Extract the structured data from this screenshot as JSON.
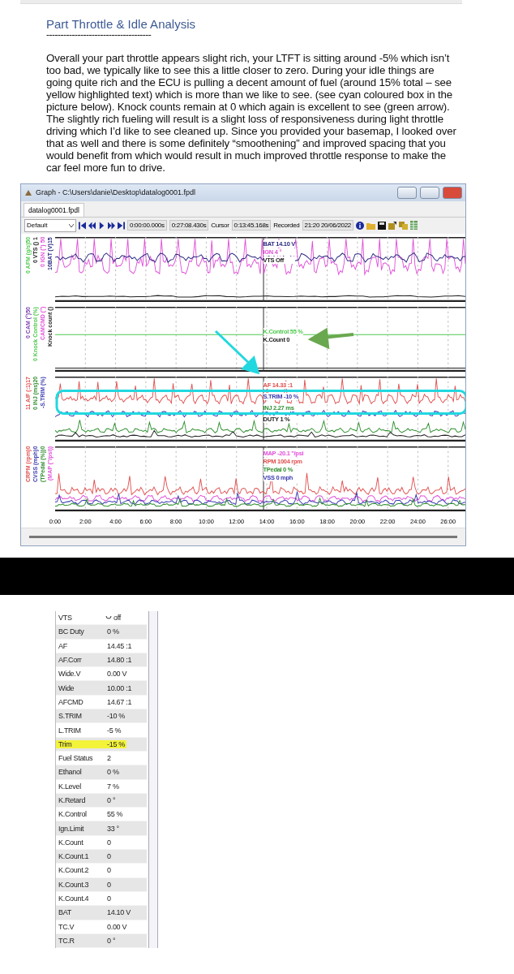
{
  "document": {
    "heading": "Part Throttle & Idle Analysis",
    "rule": "-------------------------------------",
    "paragraph": "Overall your part throttle appears slight rich, your LTFT is sitting around -5% which isn’t too bad, we typically like to see this a little closer to zero. During your idle things are going quite rich and the ECU is pulling a decent amount of fuel (around 15% total – see yellow highlighted text) which is more than we like to see. (see cyan coloured box in the picture below). Knock counts remain at 0 which again is excellent to see (green arrow). The slightly rich fueling will result is a slight loss of responsiveness during light throttle driving which I’d like to see cleaned up. Since you provided your basemap, I looked over that as well and there is some definitely “smoothening” and improved spacing that you would benefit from which would result in much improved throttle response to make the car feel more fun to drive."
  },
  "graph_window": {
    "title": "Graph - C:\\Users\\danie\\Desktop\\datalog0001.fpdl",
    "tabs": [
      {
        "label": "datalog0001.fpdl",
        "selected": true
      }
    ],
    "toolbar": {
      "preset": "Default",
      "start": "0:00:00.000s",
      "end": "0:27:08.430s",
      "cursor_label": "Cursor",
      "cursor": "0:13:45.168s",
      "recorded_label": "Recorded",
      "recorded": "21:20 20/06/2022"
    },
    "panels": [
      {
        "axis_labels": [
          {
            "text": "0 AFM (g/s)50",
            "color": "#4fc94f"
          },
          {
            "text": "0 VTS () 1",
            "color": "#222222"
          },
          {
            "text": "0 IGN (°) 50",
            "color": "#e04fd8"
          },
          {
            "text": "10BAT (V)15",
            "color": "#2a2a80"
          }
        ],
        "readouts": [
          {
            "text": "BAT 14.10 V",
            "color": "#2a2a80"
          },
          {
            "text": "IGN 4 °",
            "color": "#e04fd8"
          },
          {
            "text": "VTS Off",
            "color": "#222222"
          }
        ]
      },
      {
        "axis_labels": [
          {
            "text": "0 CAM (°)50",
            "color": "#7a3fb0"
          },
          {
            "text": "0 Knock Control (%)",
            "color": "#4fc94f"
          },
          {
            "text": "CAMCMD (°)",
            "color": "#e04fd8"
          },
          {
            "text": "Knock count ()",
            "color": "#222222"
          }
        ],
        "readouts": [
          {
            "text": "K.Control 55 %",
            "color": "#4fc94f"
          },
          {
            "text": "K.Count 0",
            "color": "#222222"
          }
        ]
      },
      {
        "axis_labels": [
          {
            "text": "11 A/F (:1)17",
            "color": "#e0504f"
          },
          {
            "text": "0 INJ (ms)20",
            "color": "#2f8f2f"
          },
          {
            "text": "-S.TRIM (%)",
            "color": "#3a3ab0"
          }
        ],
        "readouts": [
          {
            "text": "AF 14.33 :1",
            "color": "#e0504f"
          },
          {
            "text": "S.TRIM -10 %",
            "color": "#3a3ab0"
          },
          {
            "text": "INJ 2.27 ms",
            "color": "#2f8f2f"
          },
          {
            "text": "DUTY 1 %",
            "color": "#222222"
          }
        ]
      },
      {
        "axis_labels": [
          {
            "text": "CRPM (rpm)0",
            "color": "#e0504f"
          },
          {
            "text": "CVSS (mph)0",
            "color": "#3a3ab0"
          },
          {
            "text": "(TPedal (%))0",
            "color": "#2f8f2f"
          },
          {
            "text": "(MAP (\"/psi))",
            "color": "#e04fd8"
          }
        ],
        "readouts": [
          {
            "text": "MAP -20.1 \"/psi",
            "color": "#e04fd8"
          },
          {
            "text": "RPM 1004 rpm",
            "color": "#e0504f"
          },
          {
            "text": "TPedal 0 %",
            "color": "#2f8f2f"
          },
          {
            "text": "VSS 0 mph",
            "color": "#3a3ab0"
          }
        ]
      }
    ],
    "time_ticks": [
      "0:00",
      "2:00",
      "4:00",
      "6:00",
      "8:00",
      "10:00",
      "12:00",
      "14:00",
      "16:00",
      "18:00",
      "20:00",
      "22:00",
      "24:00",
      "26:00"
    ]
  },
  "parameter_table": {
    "rows": [
      {
        "name": "VTS",
        "value": "off",
        "kind": "toggle",
        "highlighted": false
      },
      {
        "name": "BC Duty",
        "value": "0 %",
        "kind": "value",
        "highlighted": false
      },
      {
        "name": "AF",
        "value": "14.45 :1",
        "kind": "value",
        "highlighted": false
      },
      {
        "name": "AF.Corr",
        "value": "14.80 :1",
        "kind": "value",
        "highlighted": false
      },
      {
        "name": "Wide.V",
        "value": "0.00 V",
        "kind": "value",
        "highlighted": false
      },
      {
        "name": "Wide",
        "value": "10.00 :1",
        "kind": "value",
        "highlighted": false
      },
      {
        "name": "AFCMD",
        "value": "14.67 :1",
        "kind": "value",
        "highlighted": false
      },
      {
        "name": "S.TRIM",
        "value": "-10 %",
        "kind": "value",
        "highlighted": false
      },
      {
        "name": "L.TRIM",
        "value": "-5 %",
        "kind": "value",
        "highlighted": false
      },
      {
        "name": "Trim",
        "value": "-15 %",
        "kind": "value",
        "highlighted": true
      },
      {
        "name": "Fuel Status",
        "value": "2",
        "kind": "value",
        "highlighted": false
      },
      {
        "name": "Ethanol",
        "value": "0 %",
        "kind": "value",
        "highlighted": false
      },
      {
        "name": "K.Level",
        "value": "7 %",
        "kind": "value",
        "highlighted": false
      },
      {
        "name": "K.Retard",
        "value": "0 °",
        "kind": "value",
        "highlighted": false
      },
      {
        "name": "K.Control",
        "value": "55 %",
        "kind": "value",
        "highlighted": false
      },
      {
        "name": "Ign.Limit",
        "value": "33 °",
        "kind": "value",
        "highlighted": false
      },
      {
        "name": "K.Count",
        "value": "0",
        "kind": "value",
        "highlighted": false
      },
      {
        "name": "K.Count.1",
        "value": "0",
        "kind": "value",
        "highlighted": false
      },
      {
        "name": "K.Count.2",
        "value": "0",
        "kind": "value",
        "highlighted": false
      },
      {
        "name": "K.Count.3",
        "value": "0",
        "kind": "value",
        "highlighted": false
      },
      {
        "name": "K.Count.4",
        "value": "0",
        "kind": "value",
        "highlighted": false
      },
      {
        "name": "BAT",
        "value": "14.10 V",
        "kind": "value",
        "highlighted": false
      },
      {
        "name": "TC.V",
        "value": "0.00 V",
        "kind": "value",
        "highlighted": false
      },
      {
        "name": "TC.R",
        "value": "0 °",
        "kind": "value",
        "highlighted": false
      }
    ]
  }
}
